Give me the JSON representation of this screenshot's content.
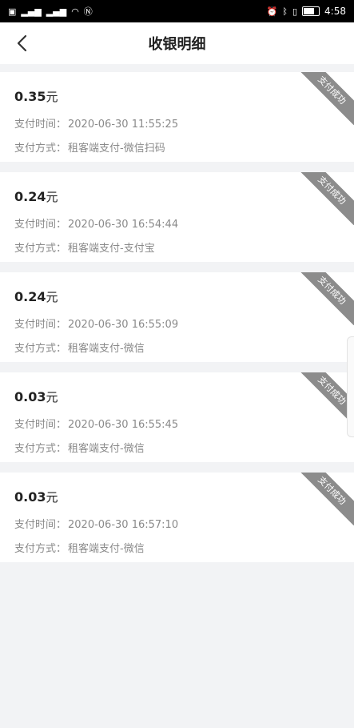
{
  "status": {
    "time": "4:58"
  },
  "header": {
    "title": "收银明细"
  },
  "labels": {
    "pay_time": "支付时间：",
    "pay_method": "支付方式：",
    "unit": "元"
  },
  "ribbon": "支付成功",
  "records": [
    {
      "amount": "0.35",
      "time": "2020-06-30 11:55:25",
      "method": "租客端支付-微信扫码"
    },
    {
      "amount": "0.24",
      "time": "2020-06-30 16:54:44",
      "method": "租客端支付-支付宝"
    },
    {
      "amount": "0.24",
      "time": "2020-06-30 16:55:09",
      "method": "租客端支付-微信"
    },
    {
      "amount": "0.03",
      "time": "2020-06-30 16:55:45",
      "method": "租客端支付-微信"
    },
    {
      "amount": "0.03",
      "time": "2020-06-30 16:57:10",
      "method": "租客端支付-微信"
    }
  ]
}
